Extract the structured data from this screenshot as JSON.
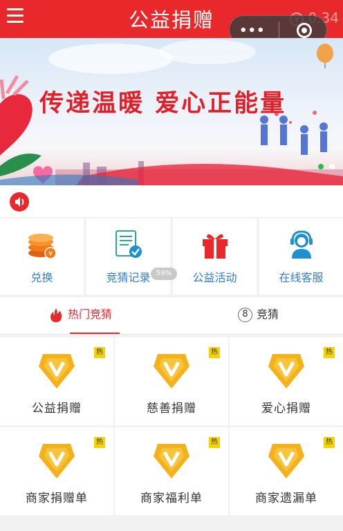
{
  "header": {
    "title": "公益捐赠",
    "menu_icon": "hamburger-menu-icon",
    "balance_text": "0.34",
    "balance_icon": "yen-coin-icon",
    "capsule": {
      "more_icon": "more-dots-icon",
      "close_icon": "target-close-icon"
    }
  },
  "banner": {
    "slogan": "传递温暖 爱心正能量",
    "active_dot_color": "#2db84d",
    "inactive_dot_color": "#ffffff"
  },
  "notice": {
    "icon": "speaker-icon",
    "text": ""
  },
  "quick_menu": [
    {
      "label": "兑换",
      "icon": "coins-icon"
    },
    {
      "label": "竞猜记录",
      "icon": "document-check-icon"
    },
    {
      "label": "公益活动",
      "icon": "gift-icon"
    },
    {
      "label": "在线客服",
      "icon": "customer-service-icon"
    }
  ],
  "progress_badge": "59%",
  "tabs": [
    {
      "label": "热门竞猜",
      "icon": "fire-icon",
      "active": true
    },
    {
      "label": "竞猜",
      "badge": "8",
      "active": false
    }
  ],
  "grid": [
    {
      "label": "公益捐赠",
      "tag": "热"
    },
    {
      "label": "慈善捐赠",
      "tag": "热"
    },
    {
      "label": "爱心捐赠",
      "tag": "热"
    },
    {
      "label": "商家捐赠单",
      "tag": "热"
    },
    {
      "label": "商家福利单",
      "tag": "热"
    },
    {
      "label": "商家遗漏单",
      "tag": "热"
    }
  ],
  "colors": {
    "brand_red": "#e8282b",
    "link_blue": "#2e7fd0",
    "medal_gold": "#f3b21b",
    "tag_yellow": "#f6d200"
  }
}
